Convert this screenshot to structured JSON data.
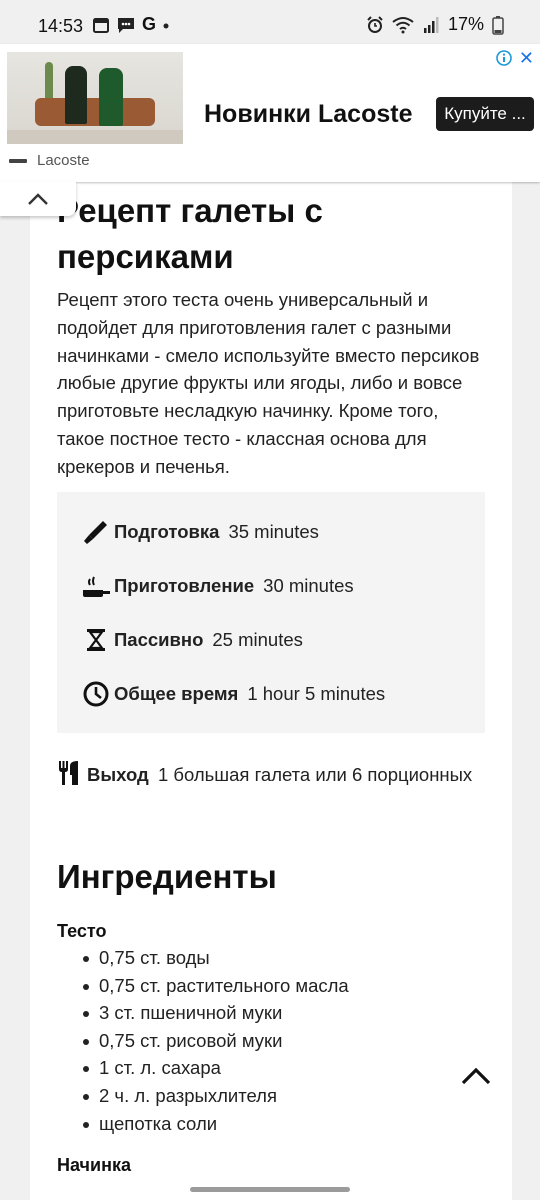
{
  "status_bar": {
    "time": "14:53",
    "battery": "17%",
    "g_letter": "G"
  },
  "ad": {
    "headline": "Новинки Lacoste",
    "cta": "Купуйте ...",
    "brand": "Lacoste",
    "close_glyph": "✕",
    "info_glyph": "i"
  },
  "recipe": {
    "title": "Рецепт галеты с персиками",
    "intro": "Рецепт этого теста очень универсальный и подойдет для приготовления галет с разными начинками - смело используйте вместо персиков любые другие фрукты или ягоды, либо и вовсе приготовьте несладкую начинку. Кроме того, такое постное тесто - классная основа для крекеров и печенья.",
    "times": [
      {
        "label": "Подготовка",
        "value": "35 minutes",
        "icon": "knife-icon"
      },
      {
        "label": "Приготовление",
        "value": "30 minutes",
        "icon": "pan-icon"
      },
      {
        "label": "Пассивно",
        "value": "25 minutes",
        "icon": "hourglass-icon"
      },
      {
        "label": "Общее время",
        "value": "1 hour 5 minutes",
        "icon": "clock-icon"
      }
    ],
    "yield": {
      "label": "Выход",
      "value": "1 большая галета или 6 порционных",
      "icon": "fork-knife-icon"
    }
  },
  "ingredients": {
    "heading": "Ингредиенты",
    "groups": [
      {
        "title": "Тесто",
        "items": [
          "0,75 ст. воды",
          "0,75 ст. растительного масла",
          "3 ст. пшеничной муки",
          "0,75 ст. рисовой муки",
          "1 ст. л. сахара",
          "2 ч. л. разрыхлителя",
          "щепотка соли"
        ]
      },
      {
        "title": "Начинка",
        "items": []
      }
    ]
  }
}
